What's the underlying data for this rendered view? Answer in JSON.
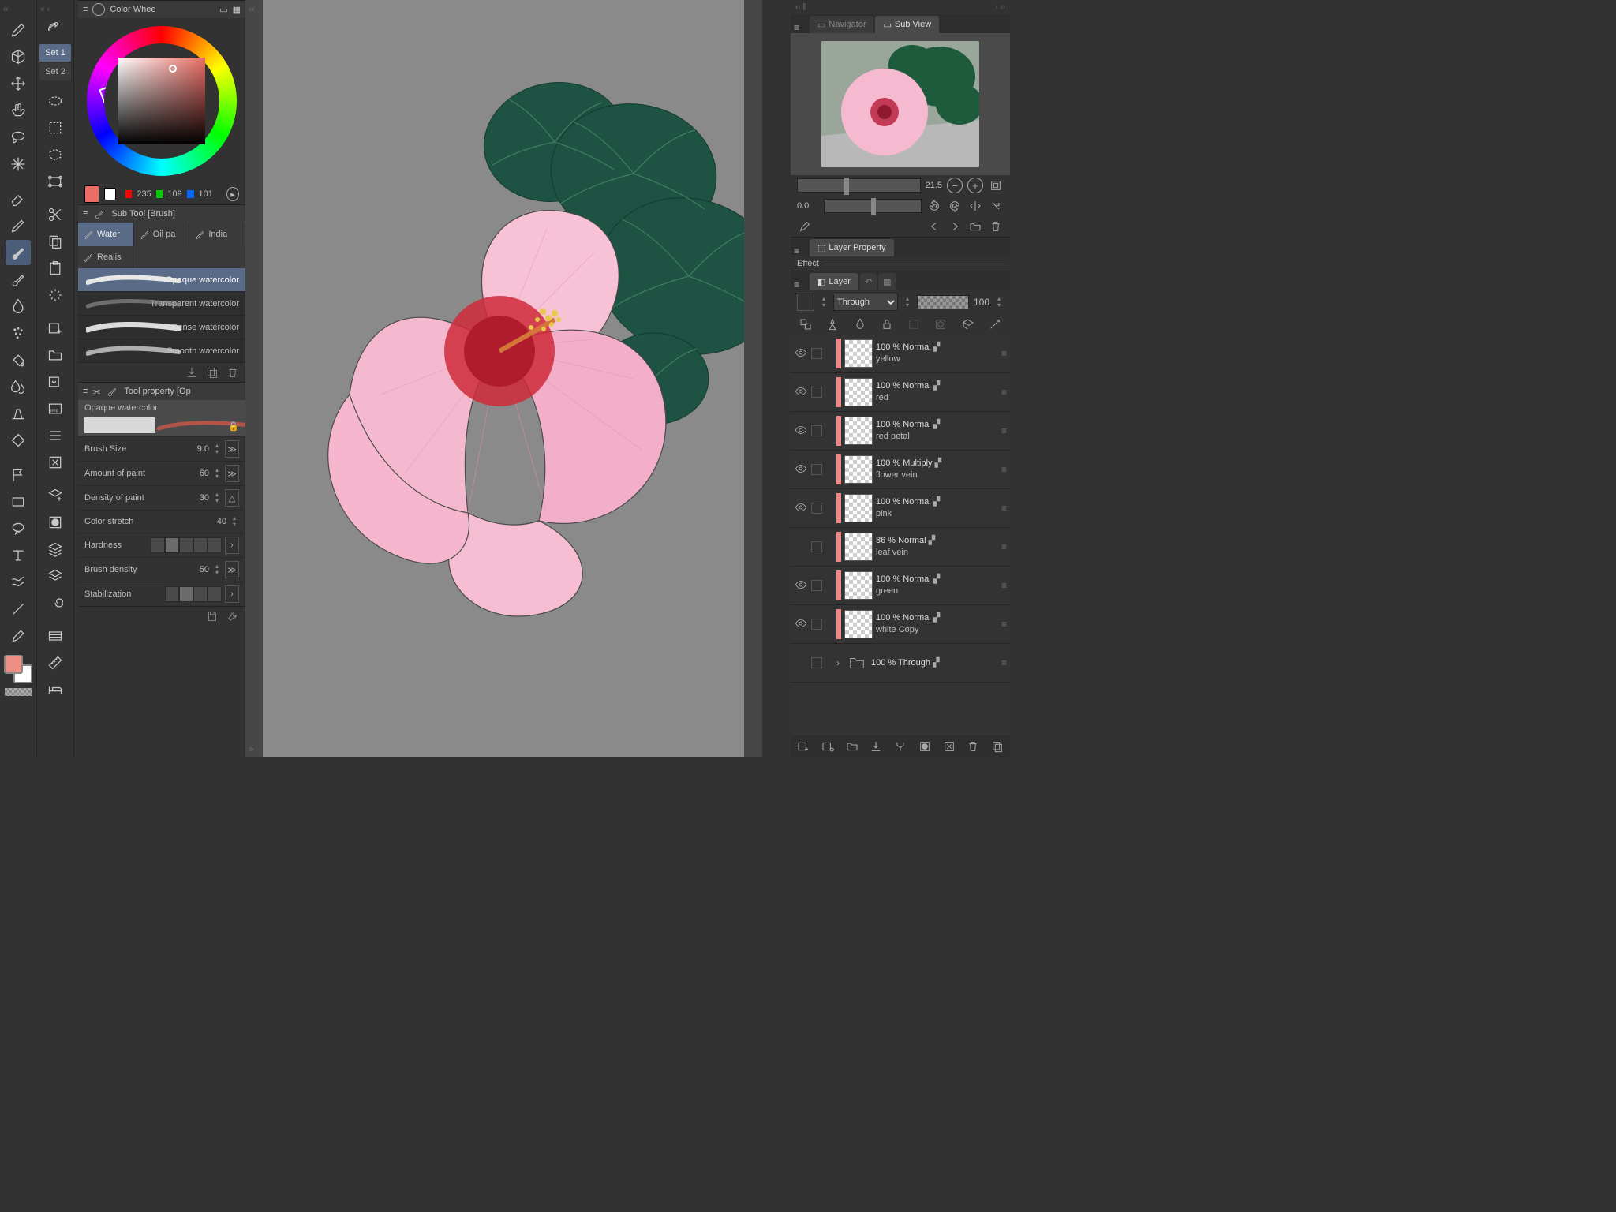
{
  "toolbar_sets": [
    "Set 1",
    "Set 2"
  ],
  "toolbar_selected_set": 0,
  "fg_color": "#ed8f85",
  "bg_color": "#ffffff",
  "color_panel": {
    "title": "Color Whee",
    "r": 235,
    "g": 109,
    "b": 101,
    "swatch": "#eb6d65"
  },
  "subtool": {
    "title": "Sub Tool [Brush]",
    "tabs": [
      "Water",
      "Oil pa",
      "India",
      "Realis"
    ],
    "selected_tab": 0,
    "brushes": [
      "Opaque watercolor",
      "Transparent watercolor",
      "Dense watercolor",
      "Smooth watercolor"
    ],
    "selected_brush": 0
  },
  "toolprop": {
    "title": "Tool property [Op",
    "name": "Opaque watercolor",
    "props": {
      "brush_size": {
        "label": "Brush Size",
        "value": "9.0"
      },
      "amount": {
        "label": "Amount of paint",
        "value": "60"
      },
      "density": {
        "label": "Density of paint",
        "value": "30"
      },
      "stretch": {
        "label": "Color stretch",
        "value": "40"
      },
      "hardness": {
        "label": "Hardness"
      },
      "bdensity": {
        "label": "Brush density",
        "value": "50"
      },
      "stab": {
        "label": "Stabilization"
      }
    }
  },
  "subview": {
    "tabs": [
      "Navigator",
      "Sub View"
    ],
    "selected_tab": 1,
    "zoom": "21.5",
    "rotation": "0.0"
  },
  "layerprop": {
    "title": "Layer Property",
    "section": "Effect"
  },
  "layerpanel": {
    "title": "Layer",
    "blend": "Through",
    "opacity": "100",
    "layers": [
      {
        "name": "yellow",
        "opacity": "100 %",
        "mode": "Normal",
        "visible": true
      },
      {
        "name": "red",
        "opacity": "100 %",
        "mode": "Normal",
        "visible": true
      },
      {
        "name": "red petal",
        "opacity": "100 %",
        "mode": "Normal",
        "visible": true
      },
      {
        "name": "flower vein",
        "opacity": "100 %",
        "mode": "Multiply",
        "visible": true
      },
      {
        "name": "pink",
        "opacity": "100 %",
        "mode": "Normal",
        "visible": true
      },
      {
        "name": "leaf vein",
        "opacity": "86 %",
        "mode": "Normal",
        "visible": false
      },
      {
        "name": "green",
        "opacity": "100 %",
        "mode": "Normal",
        "visible": true
      },
      {
        "name": "white Copy",
        "opacity": "100 %",
        "mode": "Normal",
        "visible": true
      },
      {
        "name": "",
        "opacity": "100 %",
        "mode": "Through",
        "visible": false,
        "folder": true
      }
    ]
  }
}
